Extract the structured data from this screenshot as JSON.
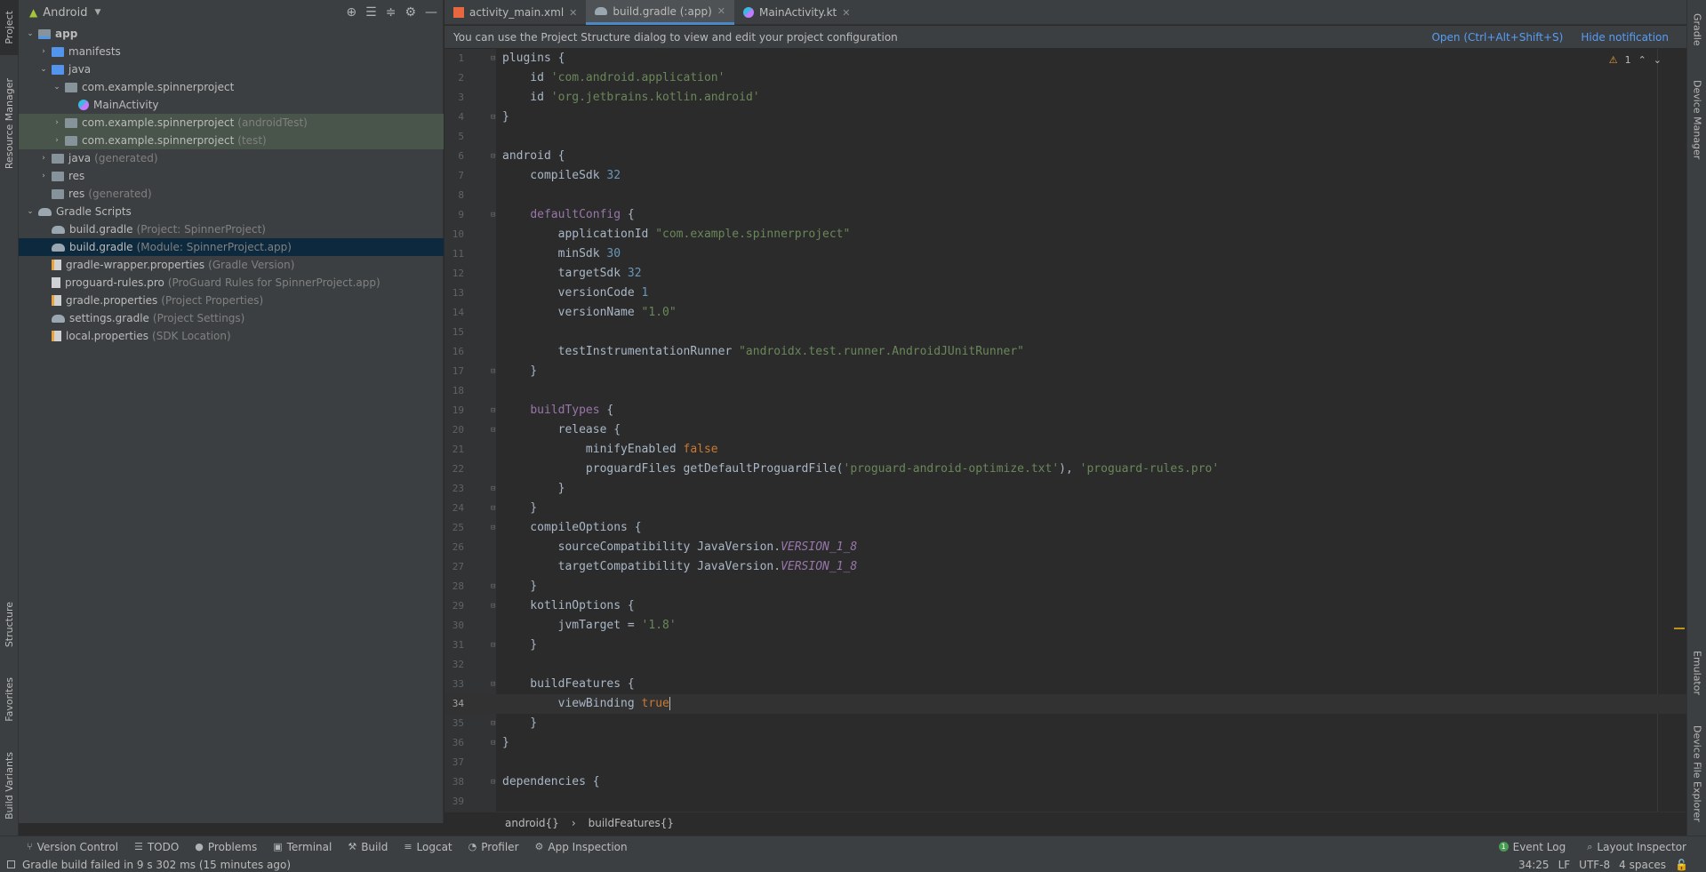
{
  "left_strip": {
    "project": "Project",
    "resource_manager": "Resource Manager",
    "structure": "Structure",
    "favorites": "Favorites",
    "build_variants": "Build Variants"
  },
  "right_strip": {
    "gradle": "Gradle",
    "device_manager": "Device Manager",
    "emulator": "Emulator",
    "device_file_explorer": "Device File Explorer"
  },
  "project_panel": {
    "view_mode": "Android",
    "tree": [
      {
        "label": "app",
        "suffix": "",
        "depth": 0,
        "arrow": "open",
        "icon": "module",
        "bold": true
      },
      {
        "label": "manifests",
        "suffix": "",
        "depth": 1,
        "arrow": "closed",
        "icon": "folder-blue"
      },
      {
        "label": "java",
        "suffix": "",
        "depth": 1,
        "arrow": "open",
        "icon": "folder-blue"
      },
      {
        "label": "com.example.spinnerproject",
        "suffix": "",
        "depth": 2,
        "arrow": "open",
        "icon": "pkg"
      },
      {
        "label": "MainActivity",
        "suffix": "",
        "depth": 3,
        "arrow": "none",
        "icon": "kt"
      },
      {
        "label": "com.example.spinnerproject",
        "suffix": "(androidTest)",
        "depth": 2,
        "arrow": "closed",
        "icon": "pkg",
        "test": true
      },
      {
        "label": "com.example.spinnerproject",
        "suffix": "(test)",
        "depth": 2,
        "arrow": "closed",
        "icon": "pkg",
        "test": true
      },
      {
        "label": "java",
        "suffix": "(generated)",
        "depth": 1,
        "arrow": "closed",
        "icon": "folder"
      },
      {
        "label": "res",
        "suffix": "",
        "depth": 1,
        "arrow": "closed",
        "icon": "folder"
      },
      {
        "label": "res",
        "suffix": "(generated)",
        "depth": 1,
        "arrow": "none",
        "icon": "folder"
      },
      {
        "label": "Gradle Scripts",
        "suffix": "",
        "depth": 0,
        "arrow": "open",
        "icon": "gradle"
      },
      {
        "label": "build.gradle",
        "suffix": "(Project: SpinnerProject)",
        "depth": 1,
        "arrow": "none",
        "icon": "gradle"
      },
      {
        "label": "build.gradle",
        "suffix": "(Module: SpinnerProject.app)",
        "depth": 1,
        "arrow": "none",
        "icon": "gradle",
        "selected": true
      },
      {
        "label": "gradle-wrapper.properties",
        "suffix": "(Gradle Version)",
        "depth": 1,
        "arrow": "none",
        "icon": "props"
      },
      {
        "label": "proguard-rules.pro",
        "suffix": "(ProGuard Rules for SpinnerProject.app)",
        "depth": 1,
        "arrow": "none",
        "icon": "pro"
      },
      {
        "label": "gradle.properties",
        "suffix": "(Project Properties)",
        "depth": 1,
        "arrow": "none",
        "icon": "props"
      },
      {
        "label": "settings.gradle",
        "suffix": "(Project Settings)",
        "depth": 1,
        "arrow": "none",
        "icon": "gradle"
      },
      {
        "label": "local.properties",
        "suffix": "(SDK Location)",
        "depth": 1,
        "arrow": "none",
        "icon": "props"
      }
    ]
  },
  "tabs": [
    {
      "label": "activity_main.xml",
      "icon": "xml",
      "active": false
    },
    {
      "label": "build.gradle (:app)",
      "icon": "gradle",
      "active": true
    },
    {
      "label": "MainActivity.kt",
      "icon": "kt",
      "active": false
    }
  ],
  "notification": {
    "text": "You can use the Project Structure dialog to view and edit your project configuration",
    "open_link": "Open (Ctrl+Alt+Shift+S)",
    "hide_link": "Hide notification"
  },
  "inspection": {
    "warnings": "1"
  },
  "editor": {
    "current_line": 34,
    "lines": [
      {
        "n": "1",
        "fold": "⊟",
        "html": "plugins {"
      },
      {
        "n": "2",
        "html": "    id <span class='s'>'com.android.application'</span>"
      },
      {
        "n": "3",
        "html": "    id <span class='s'>'org.jetbrains.kotlin.android'</span>"
      },
      {
        "n": "4",
        "fold": "⊟",
        "html": "}"
      },
      {
        "n": "5",
        "html": ""
      },
      {
        "n": "6",
        "fold": "⊟",
        "html": "android {"
      },
      {
        "n": "7",
        "html": "    compileSdk <span class='n'>32</span>"
      },
      {
        "n": "8",
        "html": ""
      },
      {
        "n": "9",
        "fold": "⊟",
        "html": "    <span class='p'>defaultConfig</span> {"
      },
      {
        "n": "10",
        "html": "        applicationId <span class='s'>\"com.example.spinnerproject\"</span>"
      },
      {
        "n": "11",
        "html": "        minSdk <span class='n'>30</span>"
      },
      {
        "n": "12",
        "html": "        targetSdk <span class='n'>32</span>"
      },
      {
        "n": "13",
        "html": "        versionCode <span class='n'>1</span>"
      },
      {
        "n": "14",
        "html": "        versionName <span class='s'>\"1.0\"</span>"
      },
      {
        "n": "15",
        "html": ""
      },
      {
        "n": "16",
        "html": "        testInstrumentationRunner <span class='s'>\"androidx.test.runner.AndroidJUnitRunner\"</span>"
      },
      {
        "n": "17",
        "fold": "⊟",
        "html": "    }"
      },
      {
        "n": "18",
        "html": ""
      },
      {
        "n": "19",
        "fold": "⊟",
        "html": "    <span class='p'>buildTypes</span> {"
      },
      {
        "n": "20",
        "fold": "⊟",
        "html": "        release {"
      },
      {
        "n": "21",
        "html": "            minifyEnabled <span class='k'>false</span>"
      },
      {
        "n": "22",
        "html": "            proguardFiles getDefaultProguardFile(<span class='s'>'proguard-android-optimize.txt'</span>), <span class='s'>'proguard-rules.pro'</span>"
      },
      {
        "n": "23",
        "fold": "⊟",
        "html": "        }"
      },
      {
        "n": "24",
        "fold": "⊟",
        "html": "    }"
      },
      {
        "n": "25",
        "fold": "⊟",
        "html": "    compileOptions {"
      },
      {
        "n": "26",
        "html": "        sourceCompatibility JavaVersion.<span class='c'>VERSION_1_8</span>"
      },
      {
        "n": "27",
        "html": "        targetCompatibility JavaVersion.<span class='c'>VERSION_1_8</span>"
      },
      {
        "n": "28",
        "fold": "⊟",
        "html": "    }"
      },
      {
        "n": "29",
        "fold": "⊟",
        "html": "    kotlinOptions {"
      },
      {
        "n": "30",
        "html": "        jvmTarget = <span class='s'>'1.8'</span>"
      },
      {
        "n": "31",
        "fold": "⊟",
        "html": "    }"
      },
      {
        "n": "32",
        "html": ""
      },
      {
        "n": "33",
        "fold": "⊟",
        "html": "    buildFeatures {"
      },
      {
        "n": "34",
        "html": "        viewBinding <span class='k'>true</span><span class='caret-bar'></span>"
      },
      {
        "n": "35",
        "fold": "⊟",
        "html": "    }"
      },
      {
        "n": "36",
        "fold": "⊟",
        "html": "}"
      },
      {
        "n": "37",
        "html": ""
      },
      {
        "n": "38",
        "fold": "⊟",
        "html": "dependencies {"
      },
      {
        "n": "39",
        "html": ""
      }
    ]
  },
  "breadcrumbs": [
    "android{}",
    "buildFeatures{}"
  ],
  "bottom_tools": [
    {
      "label": "Version Control",
      "icon": "⑂"
    },
    {
      "label": "TODO",
      "icon": "☰"
    },
    {
      "label": "Problems",
      "icon": "●"
    },
    {
      "label": "Terminal",
      "icon": "▣"
    },
    {
      "label": "Build",
      "icon": "⚒"
    },
    {
      "label": "Logcat",
      "icon": "≡"
    },
    {
      "label": "Profiler",
      "icon": "◔"
    },
    {
      "label": "App Inspection",
      "icon": "⚙"
    }
  ],
  "bottom_right_tools": {
    "event_log": "Event Log",
    "event_count": "1",
    "layout_inspector": "Layout Inspector"
  },
  "status": {
    "message": "Gradle build failed in 9 s 302 ms (15 minutes ago)",
    "position": "34:25",
    "line_sep": "LF",
    "encoding": "UTF-8",
    "indent": "4 spaces"
  }
}
